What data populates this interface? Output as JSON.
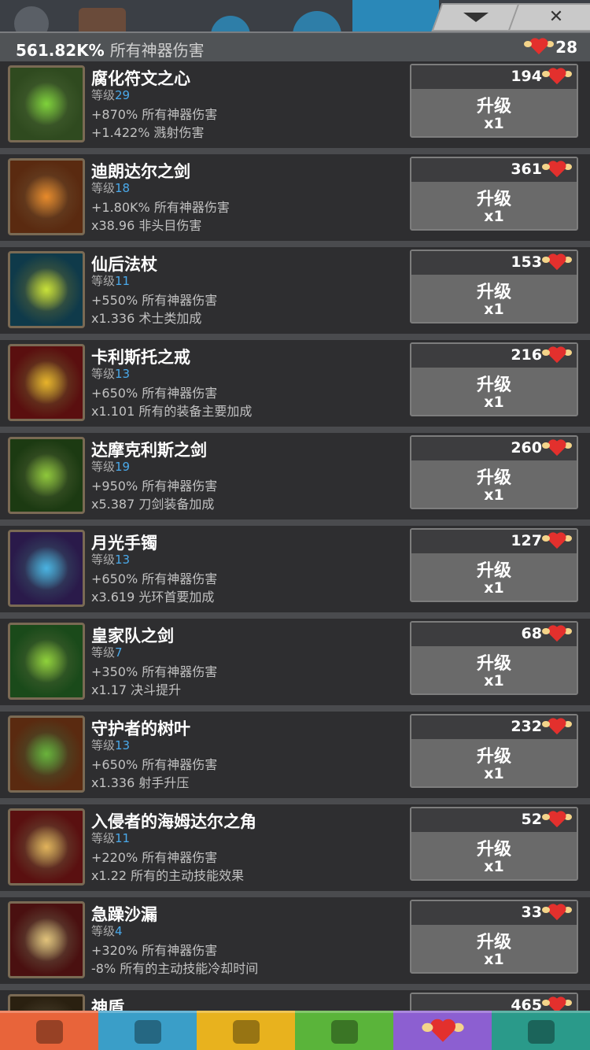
{
  "header": {
    "total_damage_value": "561.82K%",
    "total_damage_label": "所有神器伤害",
    "relic_count": "28"
  },
  "tabs": {
    "collapse_label": "⌄",
    "close_label": "✕"
  },
  "colors": {
    "level_number": "#4aa9ea",
    "active_nav": "#8c5fd1",
    "heart": "#e3302d"
  },
  "artifacts": [
    {
      "name": "腐化符文之心",
      "level_label": "等级",
      "level": "29",
      "effect1": "+870% 所有神器伤害",
      "effect2": "+1.422% 溅射伤害",
      "cost": "194",
      "upgrade_label": "升级",
      "multiplier": "x1",
      "icon": "corrupted-rune-heart-icon",
      "tint": "#2f4a1f",
      "glow": "#7ed23a"
    },
    {
      "name": "迪朗达尔之剑",
      "level_label": "等级",
      "level": "18",
      "effect1": "+1.80K% 所有神器伤害",
      "effect2": "x38.96 非头目伤害",
      "cost": "361",
      "upgrade_label": "升级",
      "multiplier": "x1",
      "icon": "durendal-sword-icon",
      "tint": "#5a2a10",
      "glow": "#e88a2a"
    },
    {
      "name": "仙后法杖",
      "level_label": "等级",
      "level": "11",
      "effect1": "+550% 所有神器伤害",
      "effect2": "x1.336 术士类加成",
      "cost": "153",
      "upgrade_label": "升级",
      "multiplier": "x1",
      "icon": "fairy-queen-staff-icon",
      "tint": "#0f3a4a",
      "glow": "#c7e23a"
    },
    {
      "name": "卡利斯托之戒",
      "level_label": "等级",
      "level": "13",
      "effect1": "+650% 所有神器伤害",
      "effect2": "x1.101 所有的装备主要加成",
      "cost": "216",
      "upgrade_label": "升级",
      "multiplier": "x1",
      "icon": "callisto-ring-icon",
      "tint": "#5a0f0f",
      "glow": "#e8b22a"
    },
    {
      "name": "达摩克利斯之剑",
      "level_label": "等级",
      "level": "19",
      "effect1": "+950% 所有神器伤害",
      "effect2": "x5.387 刀剑装备加成",
      "cost": "260",
      "upgrade_label": "升级",
      "multiplier": "x1",
      "icon": "damocles-sword-icon",
      "tint": "#1c3a12",
      "glow": "#8ec83a"
    },
    {
      "name": "月光手镯",
      "level_label": "等级",
      "level": "13",
      "effect1": "+650% 所有神器伤害",
      "effect2": "x3.619 光环首要加成",
      "cost": "127",
      "upgrade_label": "升级",
      "multiplier": "x1",
      "icon": "moonlight-bracelet-icon",
      "tint": "#2a1a4a",
      "glow": "#4ab2e2"
    },
    {
      "name": "皇家队之剑",
      "level_label": "等级",
      "level": "7",
      "effect1": "+350% 所有神器伤害",
      "effect2": "x1.17 决斗提升",
      "cost": "68",
      "upgrade_label": "升级",
      "multiplier": "x1",
      "icon": "royal-guard-sword-icon",
      "tint": "#1a4a1a",
      "glow": "#8ed23a"
    },
    {
      "name": "守护者的树叶",
      "level_label": "等级",
      "level": "13",
      "effect1": "+650% 所有神器伤害",
      "effect2": "x1.336 射手升压",
      "cost": "232",
      "upgrade_label": "升级",
      "multiplier": "x1",
      "icon": "guardian-leaf-icon",
      "tint": "#5a2a10",
      "glow": "#6ab23a"
    },
    {
      "name": "入侵者的海姆达尔之角",
      "level_label": "等级",
      "level": "11",
      "effect1": "+220% 所有神器伤害",
      "effect2": "x1.22 所有的主动技能效果",
      "cost": "52",
      "upgrade_label": "升级",
      "multiplier": "x1",
      "icon": "invader-heimdall-horn-icon",
      "tint": "#5a1010",
      "glow": "#e2b25a"
    },
    {
      "name": "急躁沙漏",
      "level_label": "等级",
      "level": "4",
      "effect1": "+320% 所有神器伤害",
      "effect2": "-8% 所有的主动技能冷却时间",
      "cost": "33",
      "upgrade_label": "升级",
      "multiplier": "x1",
      "icon": "hasty-hourglass-icon",
      "tint": "#4a1010",
      "glow": "#e2c27a"
    },
    {
      "name": "神盾",
      "level_label": "",
      "level": "",
      "effect1": "",
      "effect2": "",
      "cost": "465",
      "upgrade_label": "",
      "multiplier": "",
      "icon": "aegis-shield-icon",
      "tint": "#2a2010",
      "glow": "#a08040"
    }
  ],
  "bottom_nav": [
    {
      "name": "sword-tab",
      "icon": "sword-icon",
      "color": "#e8643a"
    },
    {
      "name": "heroes-tab",
      "icon": "helmet-icon",
      "color": "#3a9ec8"
    },
    {
      "name": "equipment-tab",
      "icon": "armor-icon",
      "color": "#e8b21e"
    },
    {
      "name": "pets-tab",
      "icon": "pet-icon",
      "color": "#5ab43a"
    },
    {
      "name": "artifacts-tab",
      "icon": "winged-heart-icon",
      "color": "#8c5fd1"
    },
    {
      "name": "shop-tab",
      "icon": "chest-icon",
      "color": "#2a9a8a"
    }
  ]
}
